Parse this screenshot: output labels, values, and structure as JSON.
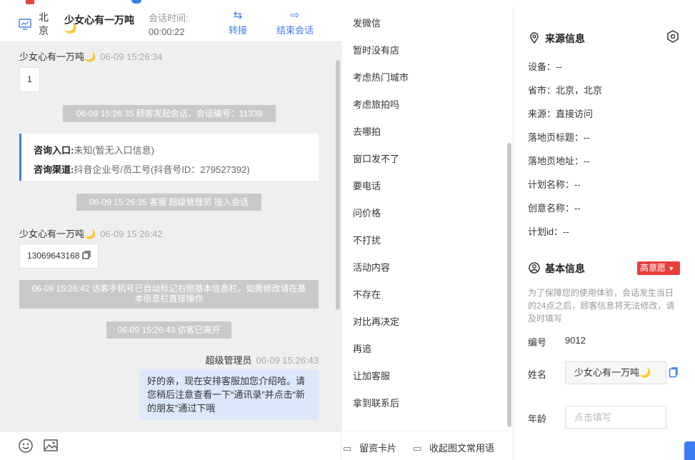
{
  "header": {
    "city": "北京",
    "visitor_name": "少女心有一万吨",
    "visitor_emoji": "🌙",
    "session_label": "会话时间:",
    "session_time": "00:00:22",
    "transfer_label": "转接",
    "end_label": "结束会话"
  },
  "chat": {
    "messages": {
      "m1_name": "少女心有一万吨🌙",
      "m1_time": "06-09 15:26:34",
      "m1_text": "1",
      "sys1": "06-09 15:26:35 顾客发起会话，会话编号：11339",
      "card_entry_label": "咨询入口:",
      "card_entry_value": "未知(暂无入口信息)",
      "card_channel_label": "咨询渠道:",
      "card_channel_value": "抖音企业号/员工号(抖音号ID：279527392)",
      "sys2": "06-09 15:26:35 客服 超级管理员 接入会话",
      "m2_name": "少女心有一万吨🌙",
      "m2_time": "06-09 15:26:42",
      "m2_text": "13069643168",
      "sys3": "06-09 15:26:42 访客手机号已自动标记右侧基本信息栏，如需修改请在基本信息栏直接操作",
      "sys4": "06-09 15:26:43 访客已离开",
      "agent_name": "超级管理员",
      "agent_time": "06-09 15:26:43",
      "agent_text": "好的亲，现在安排客服加您介绍哈。请您稍后注意查看一下“通讯录”并点击“新的朋友”通过下哦"
    }
  },
  "phrases": {
    "items": [
      "发微信",
      "暂时没有店",
      "考虑热门城市",
      "考虑旅拍吗",
      "去哪拍",
      "窗口发不了",
      "要电话",
      "问价格",
      "不打扰",
      "活动内容",
      "不存在",
      "对比再决定",
      "再追",
      "让加客服",
      "拿到联系后"
    ],
    "leave_card": "留资卡片",
    "collapse": "收起图文常用语"
  },
  "source_info": {
    "title": "来源信息",
    "device": "设备：--",
    "province": "省市：北京，北京",
    "source": "来源：直接访问",
    "landing_title": "落地页标题：--",
    "landing_url": "落地页地址：--",
    "plan_name": "计划名称：--",
    "creative_name": "创意名称：--",
    "plan_id": "计划id：--"
  },
  "basic_info": {
    "title": "基本信息",
    "intent_badge": "高意愿",
    "hint": "为了保障您的使用体验，会话发生当日的24点之后，顾客信息将无法修改，请及时填写",
    "id_label": "编号",
    "id_value": "9012",
    "name_label": "姓名",
    "name_value": "少女心有一万吨🌙",
    "age_label": "年龄",
    "age_placeholder": "点击填写"
  },
  "colors": {
    "accent": "#3b7cf0",
    "badge": "#e83e3e",
    "agent_bubble": "#dce8fc",
    "system_msg": "#c9c9c9"
  }
}
